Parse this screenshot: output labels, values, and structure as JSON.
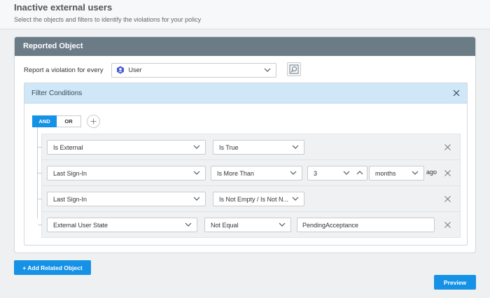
{
  "header": {
    "title": "Inactive external users",
    "subtitle": "Select the objects and filters to identify the violations for your policy"
  },
  "reported_object": {
    "title": "Reported Object",
    "label": "Report a violation for every",
    "object_value": "User",
    "object_icon": "user-hexagon-icon",
    "preview_icon": "preview-object-icon"
  },
  "filter": {
    "title": "Filter Conditions",
    "and_label": "AND",
    "or_label": "OR",
    "active_operator": "AND",
    "conditions": [
      {
        "field": "Is External",
        "operator": "Is True"
      },
      {
        "field": "Last Sign-In",
        "operator": "Is More Than",
        "value": "3",
        "unit": "months",
        "suffix": "ago"
      },
      {
        "field": "Last Sign-In",
        "operator": "Is Not Empty / Is Not N..."
      },
      {
        "field": "External User State",
        "operator": "Not Equal",
        "value": "PendingAcceptance"
      }
    ]
  },
  "actions": {
    "add_related_label": "+ Add Related Object",
    "preview_label": "Preview"
  },
  "colors": {
    "accent": "#1592e6",
    "card_header": "#6b7c87",
    "filter_header": "#cfe7f7"
  }
}
